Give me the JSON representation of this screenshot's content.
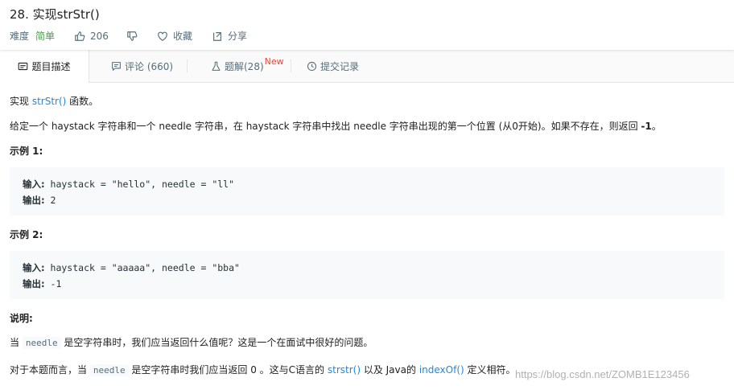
{
  "header": {
    "title": "28. 实现strStr()",
    "difficulty_label": "难度",
    "difficulty_value": "简单",
    "likes": "206",
    "favorite_label": "收藏",
    "share_label": "分享"
  },
  "tabs": {
    "description": "题目描述",
    "comments": "评论 (660)",
    "solutions": "题解(28)",
    "solutions_badge": "New",
    "submissions": "提交记录"
  },
  "content": {
    "intro_prefix": "实现 ",
    "intro_link": "strStr()",
    "intro_suffix": " 函数。",
    "desc_text": "给定一个 haystack 字符串和一个 needle 字符串，在 haystack 字符串中找出 needle 字符串出现的第一个位置 (从0开始)。如果不存在，则返回  ",
    "desc_bold": "-1",
    "desc_end": "。",
    "example1_title": "示例 1:",
    "example1_input_label": "输入:",
    "example1_input": " haystack = \"hello\", needle = \"ll\"",
    "example1_output_label": "输出:",
    "example1_output": " 2",
    "example2_title": "示例 2:",
    "example2_input_label": "输入:",
    "example2_input": " haystack = \"aaaaa\", needle = \"bba\"",
    "example2_output_label": "输出:",
    "example2_output": " -1",
    "note_title": "说明:",
    "note1_prefix": "当 ",
    "note1_code": "needle",
    "note1_suffix": " 是空字符串时，我们应当返回什么值呢？这是一个在面试中很好的问题。",
    "note2_prefix": "对于本题而言，当 ",
    "note2_code": "needle",
    "note2_mid": " 是空字符串时我们应当返回 0 。这与C语言的 ",
    "note2_link1": "strstr()",
    "note2_mid2": " 以及 Java的 ",
    "note2_link2": "indexOf()",
    "note2_end": " 定义相符。"
  },
  "watermark": "https://blog.csdn.net/ZOMB1E123456"
}
